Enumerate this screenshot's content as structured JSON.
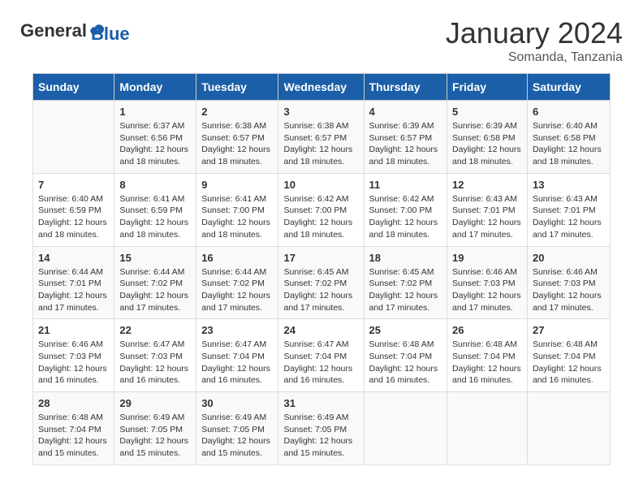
{
  "header": {
    "logo": {
      "line1": "General",
      "line2": "Blue"
    },
    "month": "January 2024",
    "location": "Somanda, Tanzania"
  },
  "weekdays": [
    "Sunday",
    "Monday",
    "Tuesday",
    "Wednesday",
    "Thursday",
    "Friday",
    "Saturday"
  ],
  "weeks": [
    [
      {
        "day": null,
        "info": null
      },
      {
        "day": "1",
        "sunrise": "6:37 AM",
        "sunset": "6:56 PM",
        "daylight": "12 hours and 18 minutes."
      },
      {
        "day": "2",
        "sunrise": "6:38 AM",
        "sunset": "6:57 PM",
        "daylight": "12 hours and 18 minutes."
      },
      {
        "day": "3",
        "sunrise": "6:38 AM",
        "sunset": "6:57 PM",
        "daylight": "12 hours and 18 minutes."
      },
      {
        "day": "4",
        "sunrise": "6:39 AM",
        "sunset": "6:57 PM",
        "daylight": "12 hours and 18 minutes."
      },
      {
        "day": "5",
        "sunrise": "6:39 AM",
        "sunset": "6:58 PM",
        "daylight": "12 hours and 18 minutes."
      },
      {
        "day": "6",
        "sunrise": "6:40 AM",
        "sunset": "6:58 PM",
        "daylight": "12 hours and 18 minutes."
      }
    ],
    [
      {
        "day": "7",
        "sunrise": "6:40 AM",
        "sunset": "6:59 PM",
        "daylight": "12 hours and 18 minutes."
      },
      {
        "day": "8",
        "sunrise": "6:41 AM",
        "sunset": "6:59 PM",
        "daylight": "12 hours and 18 minutes."
      },
      {
        "day": "9",
        "sunrise": "6:41 AM",
        "sunset": "7:00 PM",
        "daylight": "12 hours and 18 minutes."
      },
      {
        "day": "10",
        "sunrise": "6:42 AM",
        "sunset": "7:00 PM",
        "daylight": "12 hours and 18 minutes."
      },
      {
        "day": "11",
        "sunrise": "6:42 AM",
        "sunset": "7:00 PM",
        "daylight": "12 hours and 18 minutes."
      },
      {
        "day": "12",
        "sunrise": "6:43 AM",
        "sunset": "7:01 PM",
        "daylight": "12 hours and 17 minutes."
      },
      {
        "day": "13",
        "sunrise": "6:43 AM",
        "sunset": "7:01 PM",
        "daylight": "12 hours and 17 minutes."
      }
    ],
    [
      {
        "day": "14",
        "sunrise": "6:44 AM",
        "sunset": "7:01 PM",
        "daylight": "12 hours and 17 minutes."
      },
      {
        "day": "15",
        "sunrise": "6:44 AM",
        "sunset": "7:02 PM",
        "daylight": "12 hours and 17 minutes."
      },
      {
        "day": "16",
        "sunrise": "6:44 AM",
        "sunset": "7:02 PM",
        "daylight": "12 hours and 17 minutes."
      },
      {
        "day": "17",
        "sunrise": "6:45 AM",
        "sunset": "7:02 PM",
        "daylight": "12 hours and 17 minutes."
      },
      {
        "day": "18",
        "sunrise": "6:45 AM",
        "sunset": "7:02 PM",
        "daylight": "12 hours and 17 minutes."
      },
      {
        "day": "19",
        "sunrise": "6:46 AM",
        "sunset": "7:03 PM",
        "daylight": "12 hours and 17 minutes."
      },
      {
        "day": "20",
        "sunrise": "6:46 AM",
        "sunset": "7:03 PM",
        "daylight": "12 hours and 17 minutes."
      }
    ],
    [
      {
        "day": "21",
        "sunrise": "6:46 AM",
        "sunset": "7:03 PM",
        "daylight": "12 hours and 16 minutes."
      },
      {
        "day": "22",
        "sunrise": "6:47 AM",
        "sunset": "7:03 PM",
        "daylight": "12 hours and 16 minutes."
      },
      {
        "day": "23",
        "sunrise": "6:47 AM",
        "sunset": "7:04 PM",
        "daylight": "12 hours and 16 minutes."
      },
      {
        "day": "24",
        "sunrise": "6:47 AM",
        "sunset": "7:04 PM",
        "daylight": "12 hours and 16 minutes."
      },
      {
        "day": "25",
        "sunrise": "6:48 AM",
        "sunset": "7:04 PM",
        "daylight": "12 hours and 16 minutes."
      },
      {
        "day": "26",
        "sunrise": "6:48 AM",
        "sunset": "7:04 PM",
        "daylight": "12 hours and 16 minutes."
      },
      {
        "day": "27",
        "sunrise": "6:48 AM",
        "sunset": "7:04 PM",
        "daylight": "12 hours and 16 minutes."
      }
    ],
    [
      {
        "day": "28",
        "sunrise": "6:48 AM",
        "sunset": "7:04 PM",
        "daylight": "12 hours and 15 minutes."
      },
      {
        "day": "29",
        "sunrise": "6:49 AM",
        "sunset": "7:05 PM",
        "daylight": "12 hours and 15 minutes."
      },
      {
        "day": "30",
        "sunrise": "6:49 AM",
        "sunset": "7:05 PM",
        "daylight": "12 hours and 15 minutes."
      },
      {
        "day": "31",
        "sunrise": "6:49 AM",
        "sunset": "7:05 PM",
        "daylight": "12 hours and 15 minutes."
      },
      {
        "day": null,
        "info": null
      },
      {
        "day": null,
        "info": null
      },
      {
        "day": null,
        "info": null
      }
    ]
  ]
}
